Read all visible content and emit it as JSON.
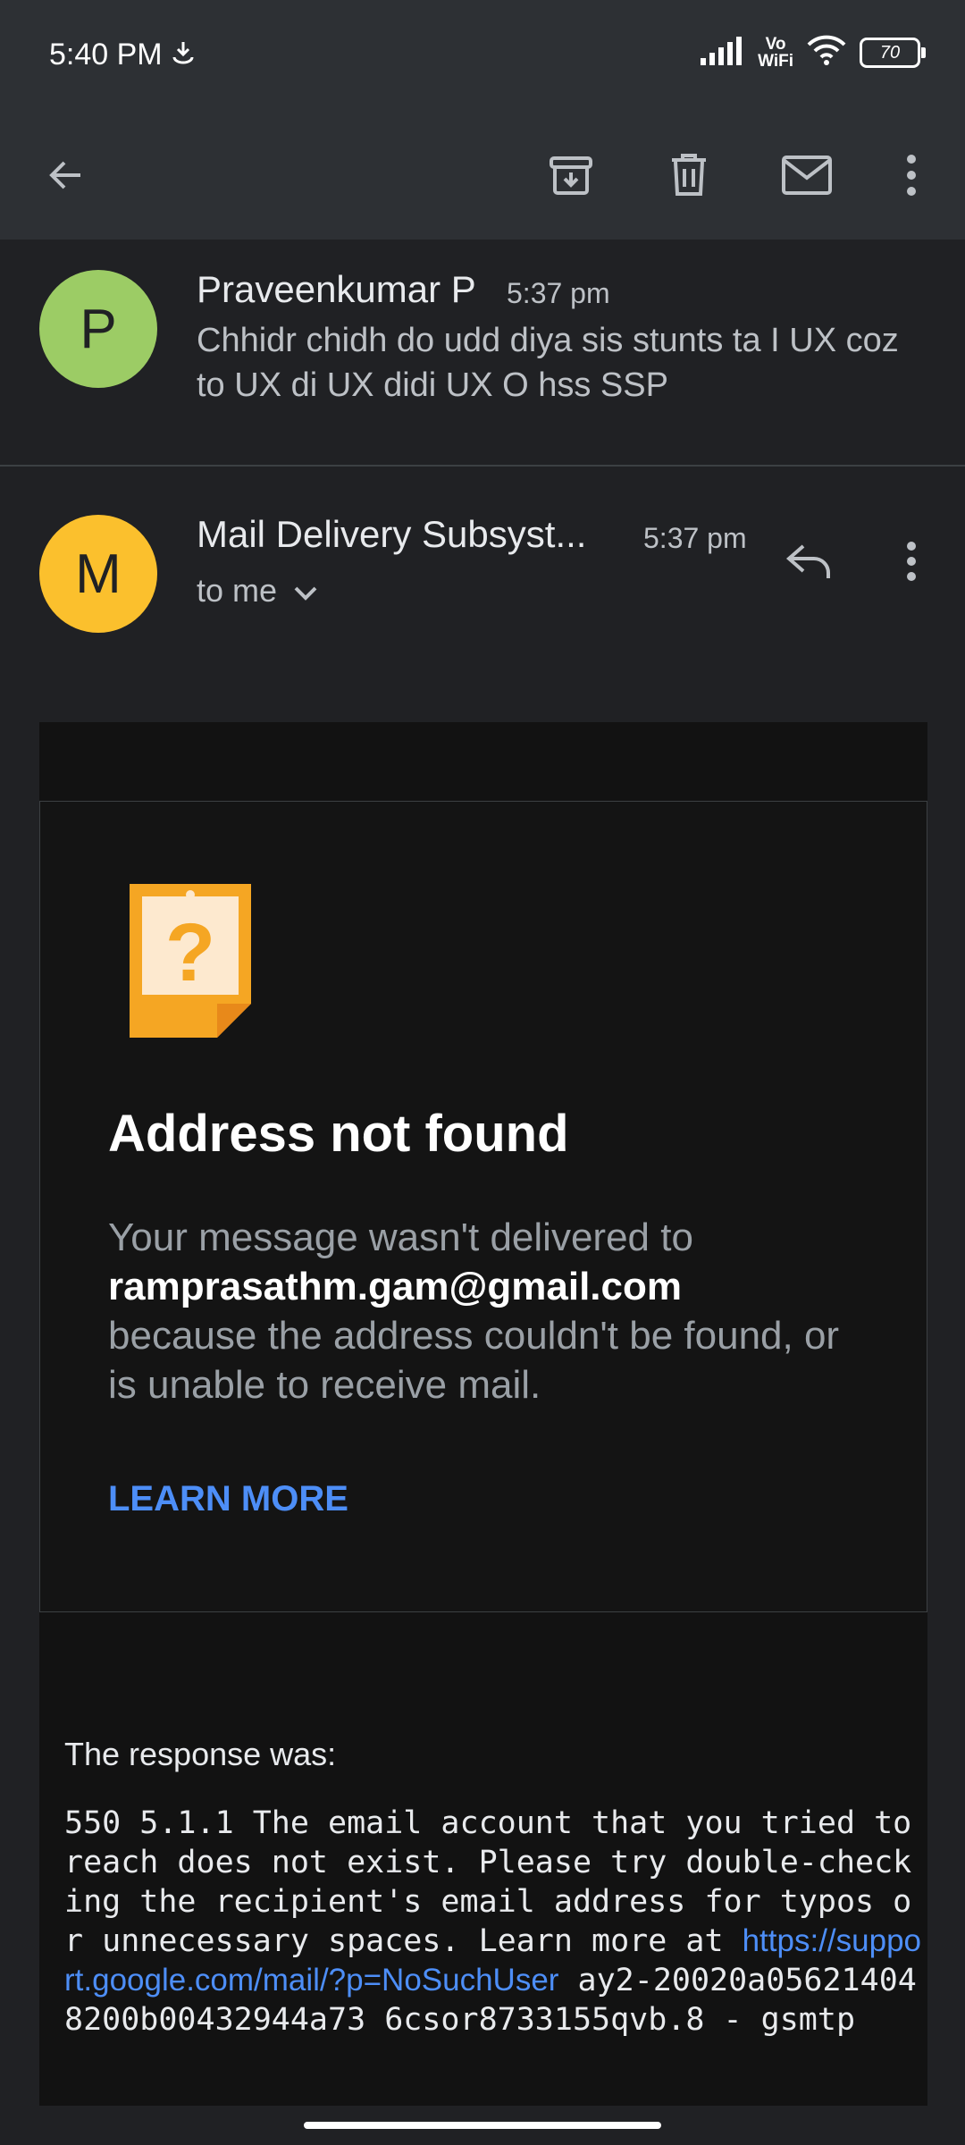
{
  "status_bar": {
    "time": "5:40 PM",
    "vowifi_top": "Vo",
    "vowifi_bottom": "WiFi",
    "battery": "70"
  },
  "toolbar": {
    "icons": [
      "back-arrow-icon",
      "archive-icon",
      "delete-icon",
      "mark-unread-icon",
      "more-vert-icon"
    ]
  },
  "previous_message": {
    "avatar_letter": "P",
    "avatar_color": "#9ccc65",
    "sender": "Praveenkumar P",
    "time": "5:37 pm",
    "snippet": "Chhidr chidh do udd diya sis stunts ta I UX coz to UX di UX didi UX O hss SSP"
  },
  "message": {
    "avatar_letter": "M",
    "avatar_color": "#fbc02d",
    "sender": "Mail Delivery Subsyst...",
    "time": "5:37 pm",
    "recipient": "to me"
  },
  "notice": {
    "title": "Address not found",
    "text_before": "Your message wasn't delivered to",
    "email": "ramprasathm.gam@gmail.com",
    "text_after": "because the address couldn't be found, or is unable to receive mail.",
    "learn_more": "LEARN MORE"
  },
  "response": {
    "label": "The response was:",
    "code_before": "550 5.1.1 The email account that you tried to reach does not exist. Please try double-checking the recipient's email address for typos or unnecessary spaces. Learn more at ",
    "link": "https://support.google.com/mail/?p=NoSuchUser",
    "code_after": " ay2-20020a056214048200b00432944a73 6csor8733155qvb.8 - gsmtp"
  }
}
